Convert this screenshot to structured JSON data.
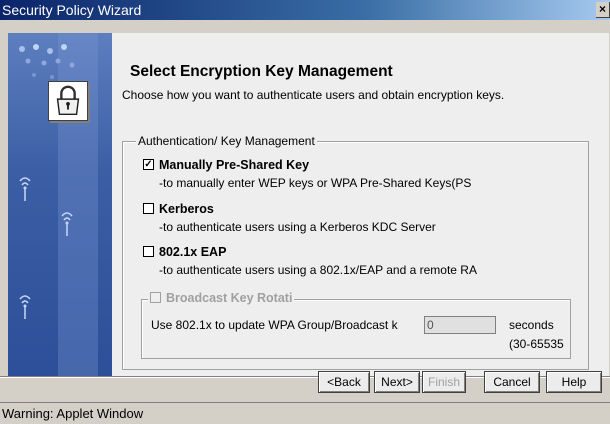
{
  "window": {
    "title": "Security Policy Wizard",
    "close_label": "×"
  },
  "page": {
    "heading": "Select Encryption Key Management",
    "subheading": "Choose how you want to authenticate users and obtain encryption keys."
  },
  "group": {
    "legend": "Authentication/ Key Management",
    "options": [
      {
        "label": "Manually Pre-Shared Key",
        "description": "-to manually enter WEP keys or WPA Pre-Shared Keys(PS",
        "checked": true
      },
      {
        "label": "Kerberos",
        "description": "-to authenticate users using a Kerberos KDC Server",
        "checked": false
      },
      {
        "label": "802.1x EAP",
        "description": "-to authenticate users using a 802.1x/EAP and a remote RA",
        "checked": false
      }
    ],
    "broadcast": {
      "legend": "Broadcast Key Rotati",
      "update_label": "Use 802.1x to update WPA Group/Broadcast k",
      "seconds_value": "0",
      "seconds_label": "seconds",
      "range_label": "(30-65535"
    }
  },
  "buttons": {
    "back": "<Back",
    "next": "Next>",
    "finish": "Finish",
    "cancel": "Cancel",
    "help": "Help"
  },
  "status": {
    "text": "Warning: Applet Window"
  }
}
